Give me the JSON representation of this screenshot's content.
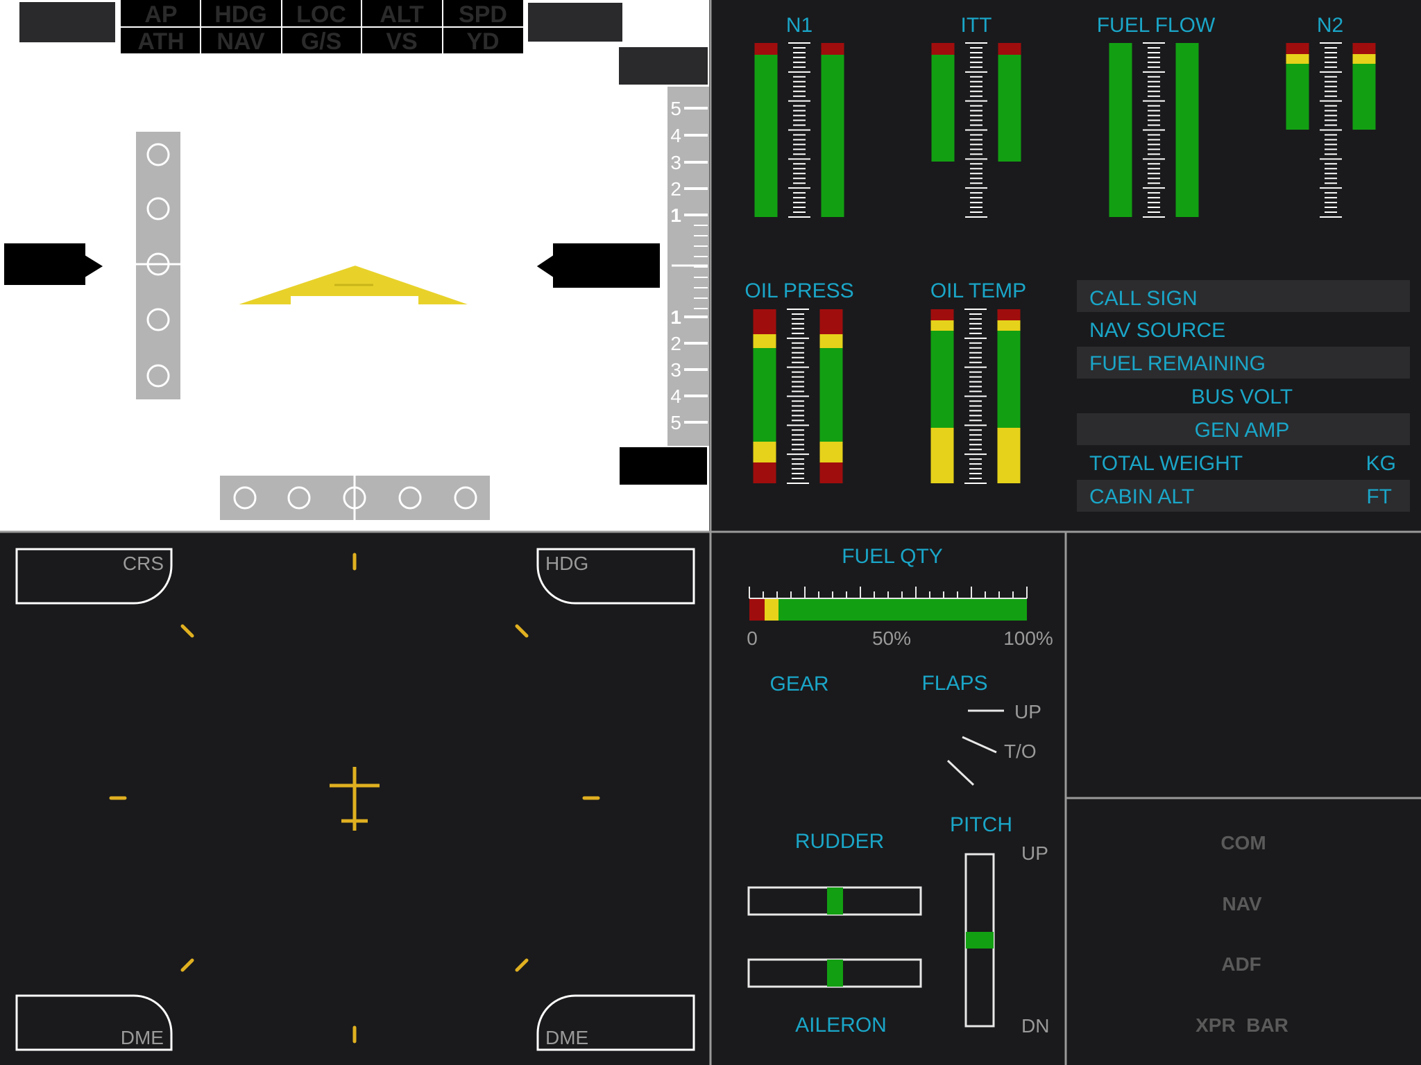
{
  "colors": {
    "background": "#1a1a1c",
    "label": "#1aa6c8",
    "gauge_green": "#12a012",
    "gauge_yellow": "#e6d21a",
    "gauge_red": "#a00d0d",
    "adi_symbol": "#e8d22a",
    "hsi_mark": "#e0b020",
    "divider": "#9a9a9a",
    "annunciator_text": "#2b2b2b"
  },
  "pfd": {
    "annunciators": {
      "row1": [
        "AP",
        "HDG",
        "LOC",
        "ALT",
        "SPD"
      ],
      "row2": [
        "ATH",
        "NAV",
        "G/S",
        "VS",
        "YD"
      ]
    },
    "vsi_scale": {
      "up_labels": [
        "5",
        "4",
        "3",
        "2",
        "1"
      ],
      "down_labels": [
        "1",
        "2",
        "3",
        "4",
        "5"
      ]
    },
    "glideslope_dots": 5,
    "localizer_dots": 5
  },
  "engine": {
    "gauges": [
      {
        "label": "N1",
        "top": [
          "red",
          "green"
        ],
        "fraction": 1.0
      },
      {
        "label": "ITT",
        "top": [
          "red",
          "green"
        ],
        "fraction": 0.68
      },
      {
        "label": "FUEL FLOW",
        "top": [
          "green"
        ],
        "fraction": 1.0
      },
      {
        "label": "N2",
        "top": [
          "red",
          "yellow",
          "green"
        ],
        "fraction": 0.5
      },
      {
        "label": "OIL PRESS",
        "top": [
          "red",
          "yellow",
          "green",
          "yellow",
          "red"
        ],
        "fraction": 1.0
      },
      {
        "label": "OIL TEMP",
        "top": [
          "red",
          "yellow",
          "green",
          "yellow"
        ],
        "fraction": 1.0
      }
    ]
  },
  "info_table": {
    "rows": [
      {
        "label": "CALL SIGN",
        "unit": ""
      },
      {
        "label": "NAV SOURCE",
        "unit": ""
      },
      {
        "label": "FUEL REMAINING",
        "unit": ""
      },
      {
        "label": "BUS VOLT",
        "unit": ""
      },
      {
        "label": "GEN AMP",
        "unit": ""
      },
      {
        "label": "TOTAL WEIGHT",
        "unit": "KG"
      },
      {
        "label": "CABIN ALT",
        "unit": "FT"
      }
    ]
  },
  "hsi": {
    "corners": {
      "tl": "CRS",
      "tr": "HDG",
      "bl": "DME",
      "br": "DME"
    }
  },
  "systems": {
    "fuel_qty": {
      "label": "FUEL QTY",
      "ticks": [
        "0",
        "50%",
        "100%"
      ],
      "fraction": 1.0
    },
    "gear_label": "GEAR",
    "flaps": {
      "label": "FLAPS",
      "positions": [
        "UP",
        "T/O"
      ]
    },
    "rudder": {
      "label": "RUDDER",
      "position": 0.5
    },
    "aileron": {
      "label": "AILERON",
      "position": 0.5
    },
    "pitch": {
      "label": "PITCH",
      "up": "UP",
      "dn": "DN",
      "position": 0.5
    }
  },
  "radios": {
    "items": [
      "COM",
      "NAV",
      "ADF",
      "XPR  BAR"
    ]
  }
}
